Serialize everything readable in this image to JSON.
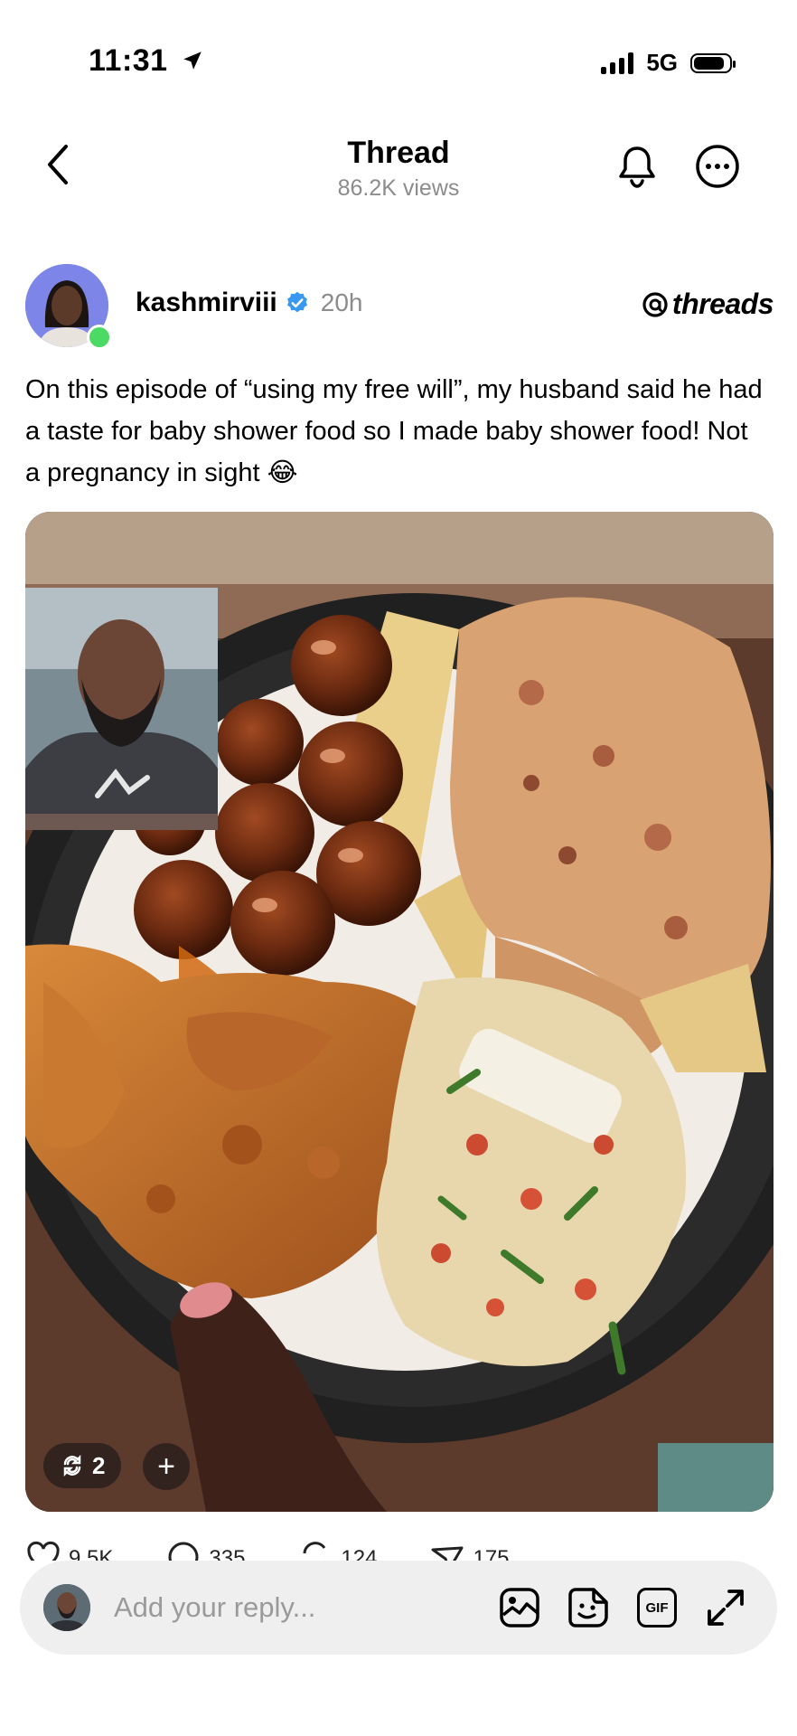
{
  "status_bar": {
    "time": "11:31",
    "network": "5G"
  },
  "header": {
    "title": "Thread",
    "views": "86.2K views"
  },
  "post": {
    "username": "kashmirviii",
    "time_ago": "20h",
    "brand": "threads",
    "text": "On this episode of “using my free will”, my husband said he had a taste for baby shower food so I made baby shower food! Not a pregnancy in sight 😂",
    "media_overlay": {
      "repost_count": "2",
      "plus_label": "+"
    }
  },
  "actions": {
    "likes": "9.5K",
    "replies": "335",
    "reposts": "124",
    "shares": "175"
  },
  "reply_bar": {
    "placeholder": "Add your reply...",
    "gif_label": "GIF"
  },
  "colors": {
    "verified_blue": "#3897f0",
    "online_green": "#4cd964",
    "muted_text": "#8c8c8c",
    "reply_bar_bg": "#efefef"
  }
}
